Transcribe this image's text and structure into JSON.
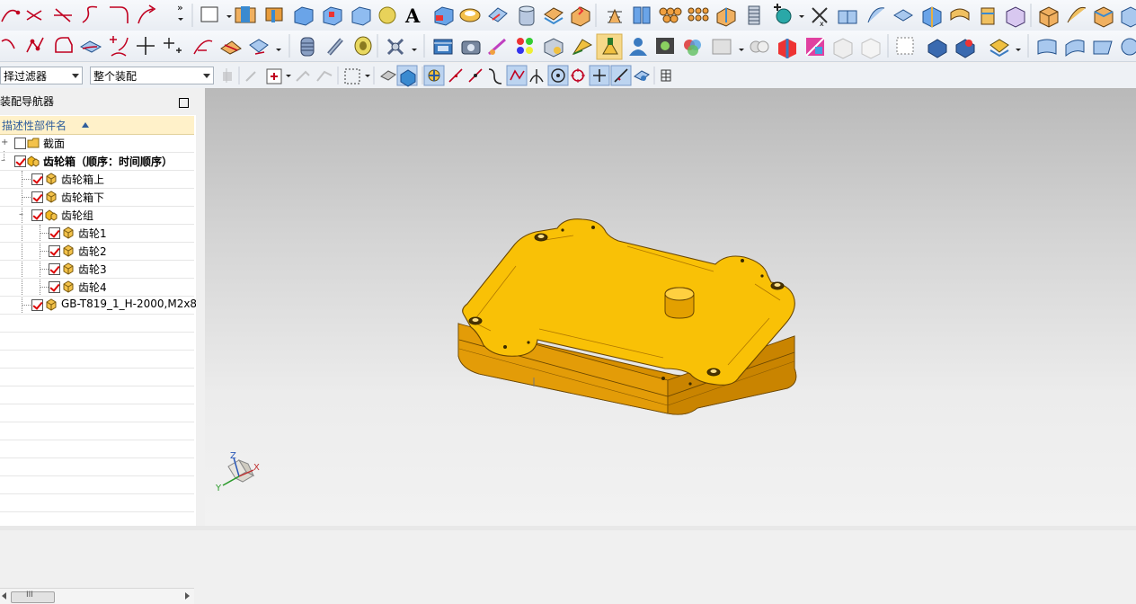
{
  "toolbar": {
    "overflow_chevron": "»",
    "filter_select": "择过滤器",
    "assembly_select": "整个装配"
  },
  "navigator": {
    "title": "装配导航器",
    "column_header": "描述性部件名",
    "items": [
      {
        "label": "截面",
        "checked": false
      },
      {
        "label": "齿轮箱（顺序：时间顺序）",
        "checked": true
      },
      {
        "label": "齿轮箱上",
        "checked": true
      },
      {
        "label": "齿轮箱下",
        "checked": true
      },
      {
        "label": "齿轮组",
        "checked": true
      },
      {
        "label": "齿轮1",
        "checked": true
      },
      {
        "label": "齿轮2",
        "checked": true
      },
      {
        "label": "齿轮3",
        "checked": true
      },
      {
        "label": "齿轮4",
        "checked": true
      },
      {
        "label": "GB-T819_1_H-2000,M2x8",
        "checked": true
      }
    ],
    "scroll_grip": "III"
  },
  "triad": {
    "x_label": "X",
    "y_label": "Y",
    "z_label": "Z"
  },
  "colors": {
    "part": "#f5b800",
    "part_edge": "#7a5200",
    "panel_header": "#fff1c9",
    "checkbox_check": "#dd0000"
  }
}
